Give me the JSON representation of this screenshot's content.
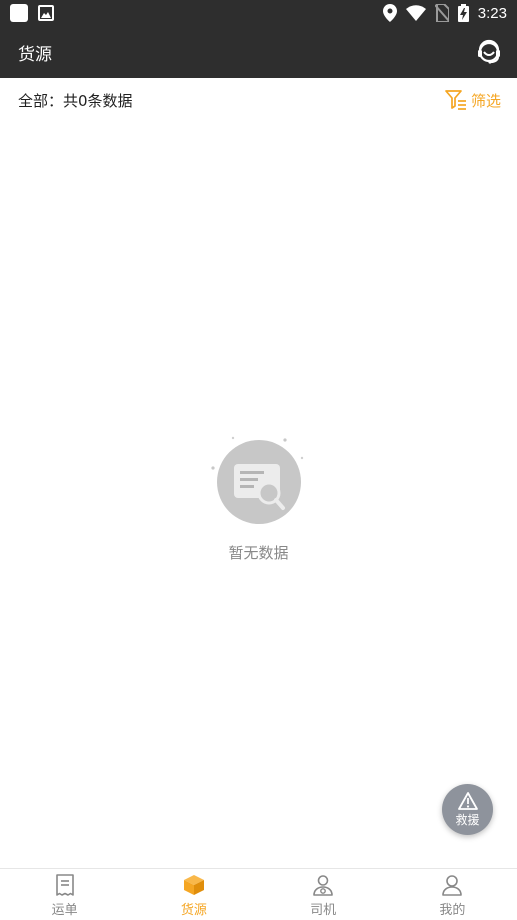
{
  "status_bar": {
    "time": "3:23"
  },
  "header": {
    "title": "货源"
  },
  "summary": {
    "text": "全部：共0条数据",
    "filter_label": "筛选"
  },
  "empty_state": {
    "message": "暂无数据"
  },
  "fab": {
    "label": "救援"
  },
  "bottom_nav": {
    "items": [
      {
        "label": "运单",
        "icon": "waybill-icon",
        "active": false
      },
      {
        "label": "货源",
        "icon": "cargo-box-icon",
        "active": true
      },
      {
        "label": "司机",
        "icon": "driver-icon",
        "active": false
      },
      {
        "label": "我的",
        "icon": "profile-icon",
        "active": false
      }
    ]
  },
  "colors": {
    "accent": "#f5a623",
    "header_bg": "#2e2e2e",
    "fab_bg": "#8e939c",
    "inactive": "#888888"
  }
}
